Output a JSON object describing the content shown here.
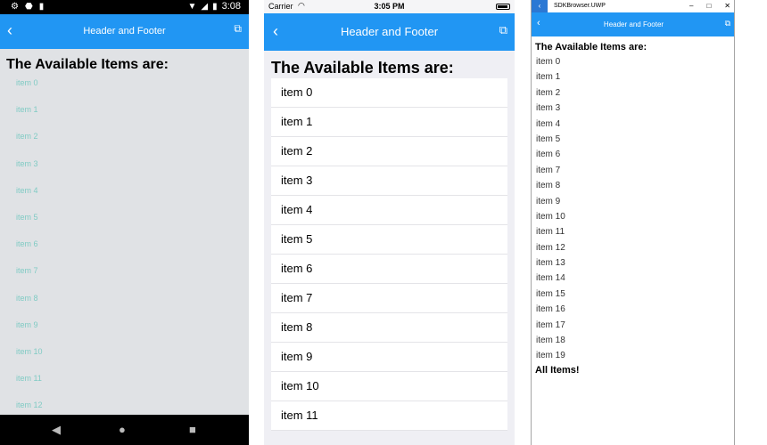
{
  "android": {
    "status": {
      "time": "3:08"
    },
    "toolbar": {
      "back_icon": "arrow-left-icon",
      "title": "Header and Footer",
      "external_icon": "external-link-icon"
    },
    "header": "The Available Items are:",
    "items": [
      "item 0",
      "item 1",
      "item 2",
      "item 3",
      "item 4",
      "item 5",
      "item 6",
      "item 7",
      "item 8",
      "item 9",
      "item 10",
      "item 11",
      "item 12"
    ],
    "colors": {
      "toolbar": "#2196f3",
      "item_text": "#80cbc4",
      "background": "#e0e2e5"
    }
  },
  "ios": {
    "status": {
      "carrier": "Carrier",
      "time": "3:05 PM"
    },
    "toolbar": {
      "back_icon": "chevron-left-icon",
      "title": "Header and Footer",
      "external_icon": "external-link-icon"
    },
    "header": "The Available Items are:",
    "items": [
      "item 0",
      "item 1",
      "item 2",
      "item 3",
      "item 4",
      "item 5",
      "item 6",
      "item 7",
      "item 8",
      "item 9",
      "item 10",
      "item 11"
    ],
    "colors": {
      "toolbar": "#2196f3",
      "background": "#efeff4"
    }
  },
  "uwp": {
    "titlebar": {
      "app_name": "SDKBrowser.UWP",
      "minimize": "–",
      "maximize": "□",
      "close": "✕"
    },
    "toolbar": {
      "back_icon": "chevron-left-icon",
      "title": "Header and Footer",
      "external_icon": "external-link-icon"
    },
    "header": "The Available Items are:",
    "items": [
      "item 0",
      "item 1",
      "item 2",
      "item 3",
      "item 4",
      "item 5",
      "item 6",
      "item 7",
      "item 8",
      "item 9",
      "item 10",
      "item 11",
      "item 12",
      "item 13",
      "item 14",
      "item 15",
      "item 16",
      "item 17",
      "item 18",
      "item 19"
    ],
    "footer": "All Items!",
    "colors": {
      "toolbar": "#2196f3",
      "titlebar_back": "#2b78d4"
    }
  }
}
